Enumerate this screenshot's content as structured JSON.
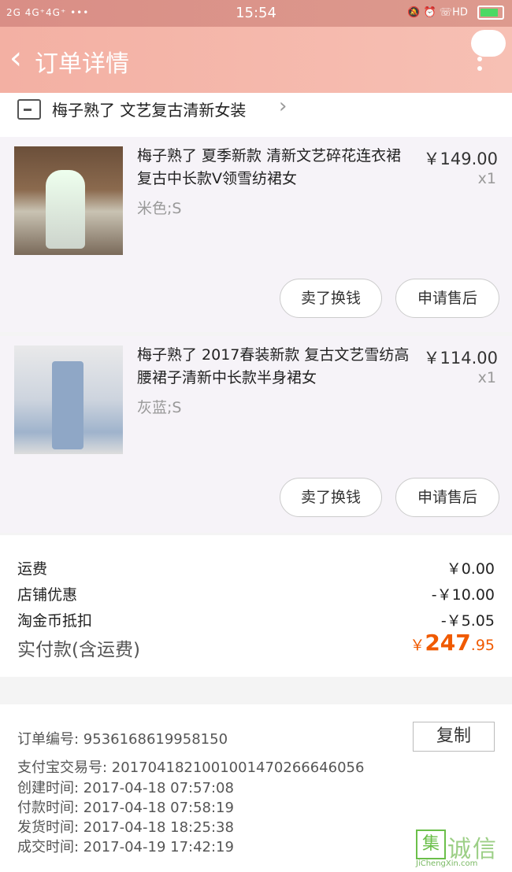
{
  "status_bar": {
    "left": "2G 4G⁺4G⁺ •••",
    "time": "15:54",
    "right": "HD"
  },
  "nav": {
    "title": "订单详情"
  },
  "shop": {
    "name": "梅子熟了 文艺复古清新女装"
  },
  "items": [
    {
      "title": "梅子熟了 夏季新款 清新文艺碎花连衣裙 复古中长款V领雪纺裙女",
      "sku": "米色;S",
      "price": "￥149.00",
      "qty": "x1",
      "btn_sell": "卖了换钱",
      "btn_aftersale": "申请售后"
    },
    {
      "title": "梅子熟了 2017春装新款 复古文艺雪纺高腰裙子清新中长款半身裙女",
      "sku": "灰蓝;S",
      "price": "￥114.00",
      "qty": "x1",
      "btn_sell": "卖了换钱",
      "btn_aftersale": "申请售后"
    }
  ],
  "fees": [
    {
      "label": "运费",
      "value": "￥0.00"
    },
    {
      "label": "店铺优惠",
      "value": "-￥10.00"
    },
    {
      "label": "淘金币抵扣",
      "value": "-￥5.05"
    }
  ],
  "total": {
    "label": "实付款(含运费)",
    "currency": "￥",
    "int": "247",
    "dec": ".95"
  },
  "order_info": {
    "order_no": "订单编号:  9536168619958150",
    "copy_label": "复制",
    "alipay_no": "支付宝交易号:  2017041821001001470266646056",
    "created": "创建时间:  2017-04-18  07:57:08",
    "paid": "付款时间:  2017-04-18  07:58:19",
    "shipped": "发货时间:  2017-04-18  18:25:38",
    "completed": "成交时间:  2017-04-19  17:42:19"
  },
  "watermark": {
    "mark": "集",
    "text": "诚信",
    "url": "JiChengXin.com"
  }
}
